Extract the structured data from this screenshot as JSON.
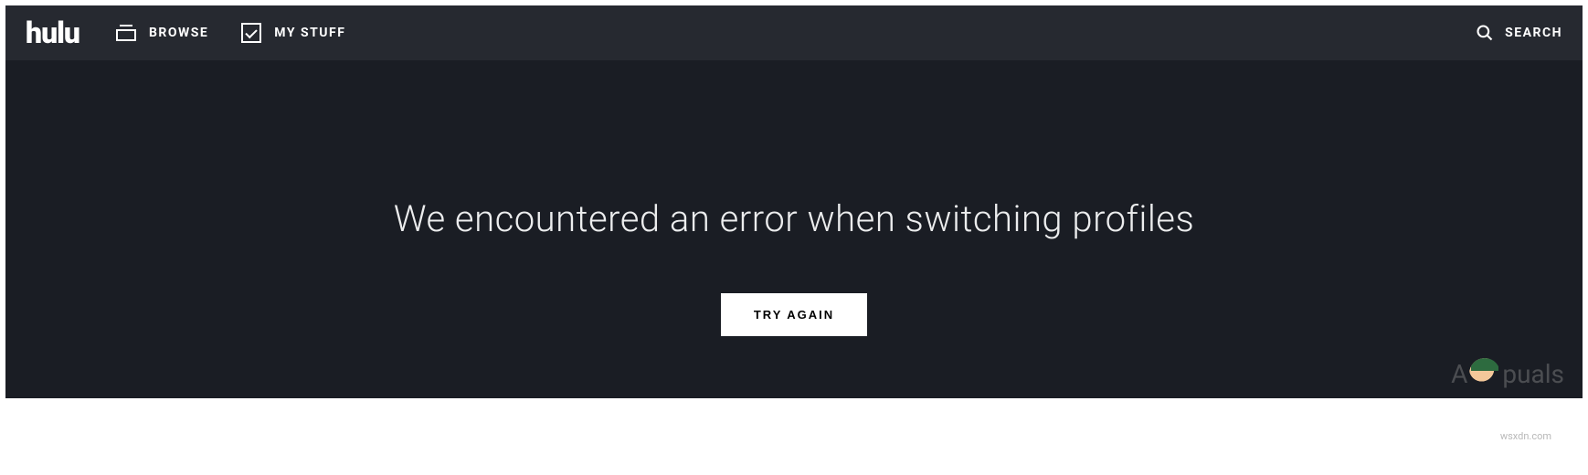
{
  "brand": {
    "logo_text": "hulu"
  },
  "nav": {
    "browse_label": "BROWSE",
    "mystuff_label": "MY STUFF",
    "search_label": "SEARCH"
  },
  "main": {
    "error_message": "We encountered an error when switching profiles",
    "try_again_label": "TRY AGAIN"
  },
  "watermark": {
    "prefix": "A",
    "suffix": "puals",
    "small_text": "wsxdn.com"
  }
}
